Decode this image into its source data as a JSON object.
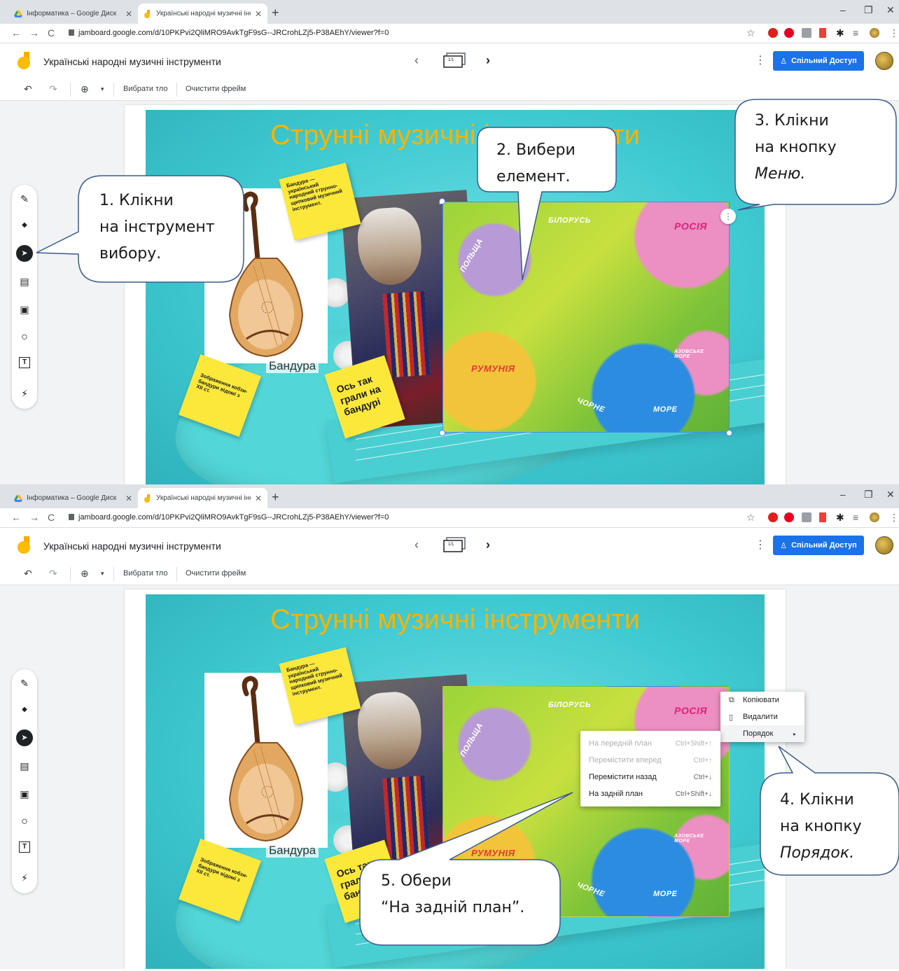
{
  "browser": {
    "tabs": [
      {
        "label": "Інформатика – Google Диск",
        "close": "✕"
      },
      {
        "label": "Українські народні музичні інст",
        "close": "✕"
      }
    ],
    "new_tab": "+",
    "window_controls": {
      "minimize": "–",
      "maximize": "❐",
      "close": "✕"
    },
    "nav": {
      "back": "←",
      "forward": "→",
      "reload": "C"
    },
    "url": "jamboard.google.com/d/10PKPvi2QliMRO9AvkTgF9sG--JRCrohLZj5-P38AEhY/viewer?f=0"
  },
  "app": {
    "title": "Українські народні музичні інструменти",
    "frame_indicator": "1/1",
    "frame_prev": "‹",
    "frame_next": "›",
    "more_menu": "⋮",
    "share_label": "Спільний Доступ"
  },
  "toolbar": {
    "undo": "↶",
    "redo": "↷",
    "zoom": "⊕",
    "zoom_dropdown": "▾",
    "set_background": "Вибрати тло",
    "clear_frame": "Очистити фрейм"
  },
  "palette": [
    {
      "name": "pen",
      "icon": "✎"
    },
    {
      "name": "eraser",
      "icon": "◆"
    },
    {
      "name": "select",
      "icon": "➤"
    },
    {
      "name": "sticky-note",
      "icon": "▤"
    },
    {
      "name": "image",
      "icon": "▣"
    },
    {
      "name": "circle",
      "icon": "○"
    },
    {
      "name": "text-box",
      "icon": "T"
    },
    {
      "name": "laser",
      "icon": "⚡"
    }
  ],
  "slide": {
    "title": "Струнні музичні інструменти",
    "sticky_description": "Бандура — український народний струнно-щипковий музичний інструмент.",
    "sticky_kobza": "Зображення кобзи-бандури відомі з XII ст.",
    "sticky_played": "Ось так грали на бандурі",
    "caption": "Бандура",
    "map_labels": {
      "belarus": "БІЛОРУСЬ",
      "russia": "РОСІЯ",
      "poland": "ПОЛЬЩА",
      "romania": "РУМУНІЯ",
      "black_sea_1": "ЧОРНЕ",
      "black_sea_2": "МОРЕ",
      "azov_sea": "АЗОВСЬКЕ МОРЕ"
    }
  },
  "callouts": {
    "step1": [
      "1. Клікни",
      "на інструмент",
      "вибору."
    ],
    "step2": [
      "2. Вибери",
      "елемент."
    ],
    "step3": [
      "3. Клікни",
      "на кнопку",
      "Меню."
    ],
    "step4": [
      "4. Клікни",
      "на кнопку",
      "Порядок."
    ],
    "step5": [
      "5. Обери",
      "“На задній план”."
    ]
  },
  "menu_main": [
    {
      "icon": "⧉",
      "label": "Копіювати"
    },
    {
      "icon": "🗑",
      "label": "Видалити"
    },
    {
      "icon": "",
      "label": "Порядок",
      "arrow": "▸"
    }
  ],
  "menu_order": [
    {
      "label": "На передній план",
      "shortcut": "Ctrl+Shift+↑",
      "enabled": false
    },
    {
      "label": "Перемістити вперед",
      "shortcut": "Ctrl+↑",
      "enabled": false
    },
    {
      "label": "Перемістити назад",
      "shortcut": "Ctrl+↓",
      "enabled": true
    },
    {
      "label": "На задній план",
      "shortcut": "Ctrl+Shift+↓",
      "enabled": true
    }
  ],
  "colors": {
    "title_orange": "#f5b400",
    "slide_cyan": "#3fc9d1",
    "sticky_yellow": "#fce83a",
    "share_blue": "#1a73e8",
    "callout_stroke": "#3b5b8a"
  }
}
